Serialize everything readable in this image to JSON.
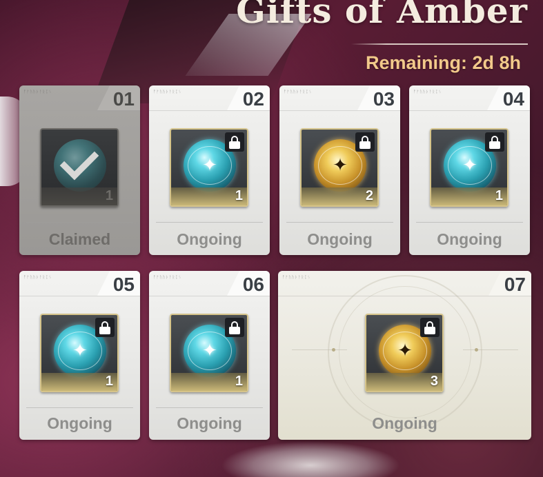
{
  "header": {
    "title": "Gifts of Amber",
    "remaining": "Remaining: 2d 8h"
  },
  "cards": [
    {
      "num": "01",
      "code": "ᚡᚠᚢᚤᚦᚨᚱᛈᛊ",
      "status": "Claimed",
      "count": "1",
      "orb": "teal",
      "state": "claimed"
    },
    {
      "num": "02",
      "code": "ᚡᚠᚢᚤᚦᚨᚱᛈᛊ",
      "status": "Ongoing",
      "count": "1",
      "orb": "teal",
      "state": "locked"
    },
    {
      "num": "03",
      "code": "ᚡᚠᚢᚤᚦᚨᚱᛈᛊ",
      "status": "Ongoing",
      "count": "2",
      "orb": "gold",
      "state": "locked"
    },
    {
      "num": "04",
      "code": "ᚡᚠᚢᚤᚦᚨᚱᛈᛊ",
      "status": "Ongoing",
      "count": "1",
      "orb": "teal",
      "state": "locked"
    },
    {
      "num": "05",
      "code": "ᚡᚠᚢᚤᚦᚨᚱᛈᛊ",
      "status": "Ongoing",
      "count": "1",
      "orb": "teal",
      "state": "locked"
    },
    {
      "num": "06",
      "code": "ᚡᚠᚢᚤᚦᚨᚱᛈᛊ",
      "status": "Ongoing",
      "count": "1",
      "orb": "teal",
      "state": "locked"
    },
    {
      "num": "07",
      "code": "ᚡᚠᚢᚤᚦᚨᚱᛈᛊ",
      "status": "Ongoing",
      "count": "3",
      "orb": "gold",
      "state": "locked"
    }
  ],
  "colors": {
    "title": "#f4ecdf",
    "remaining": "#f2c98a",
    "card_num": "#3a3f45",
    "status": "#8e8e8c",
    "item_border": "#d6c48a"
  },
  "icons": {
    "claimed": "checkmark-icon",
    "locked": "lock-icon",
    "reward_teal": "teal-orb-icon",
    "reward_gold": "gold-orb-icon"
  }
}
